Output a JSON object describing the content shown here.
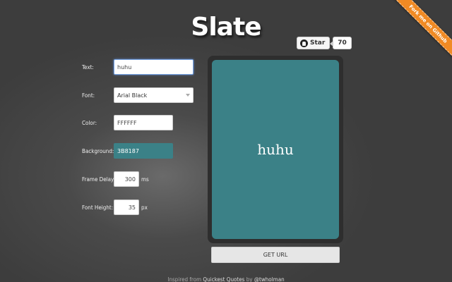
{
  "app": {
    "title": "Slate"
  },
  "ribbon": {
    "label": "Fork me on Github"
  },
  "github": {
    "star_label": "Star",
    "star_count": "70",
    "icon": "github-icon"
  },
  "form": {
    "text": {
      "label": "Text:",
      "value": "huhu"
    },
    "font": {
      "label": "Font:",
      "selected": "Arial Black"
    },
    "color": {
      "label": "Color:",
      "value": "FFFFFF"
    },
    "background": {
      "label": "Background:",
      "value": "3B8187"
    },
    "frame_delay": {
      "label": "Frame Delay:",
      "value": "300",
      "unit": "ms"
    },
    "font_height": {
      "label": "Font Height:",
      "value": "35",
      "unit": "px"
    }
  },
  "preview": {
    "text": "huhu",
    "bg_color": "#3b8187",
    "text_color": "#FFFFFF"
  },
  "actions": {
    "get_url_label": "GET URL"
  },
  "footer": {
    "prefix": "Inspired from ",
    "link1": "Quickest Quotes",
    "mid": " by ",
    "link2": "@twholman"
  }
}
